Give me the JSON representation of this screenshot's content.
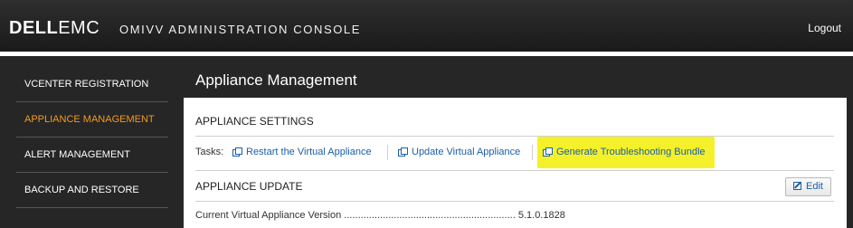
{
  "header": {
    "logo_bold": "DELL",
    "logo_rest": "EMC",
    "app_title": "OMIVV ADMINISTRATION CONSOLE",
    "logout_label": "Logout"
  },
  "sidebar": {
    "items": [
      {
        "label": "VCENTER REGISTRATION",
        "active": false
      },
      {
        "label": "APPLIANCE MANAGEMENT",
        "active": true
      },
      {
        "label": "ALERT MANAGEMENT",
        "active": false
      },
      {
        "label": "BACKUP AND RESTORE",
        "active": false
      }
    ]
  },
  "main": {
    "title": "Appliance Management",
    "settings": {
      "header": "APPLIANCE SETTINGS",
      "tasks_label": "Tasks:",
      "tasks": [
        {
          "label": "Restart the Virtual Appliance"
        },
        {
          "label": "Update Virtual Appliance"
        },
        {
          "label": "Generate Troubleshooting Bundle",
          "highlighted": true
        }
      ]
    },
    "update": {
      "header": "APPLIANCE UPDATE",
      "edit_label": "Edit",
      "version_label": "Current Virtual Appliance Version",
      "version_value": "5.1.0.1828"
    }
  },
  "colors": {
    "topbar": "#1f1f1f",
    "shell": "#262626",
    "active_nav": "#f39a1e",
    "link": "#1a5fa8",
    "highlight": "#f4f12a"
  }
}
